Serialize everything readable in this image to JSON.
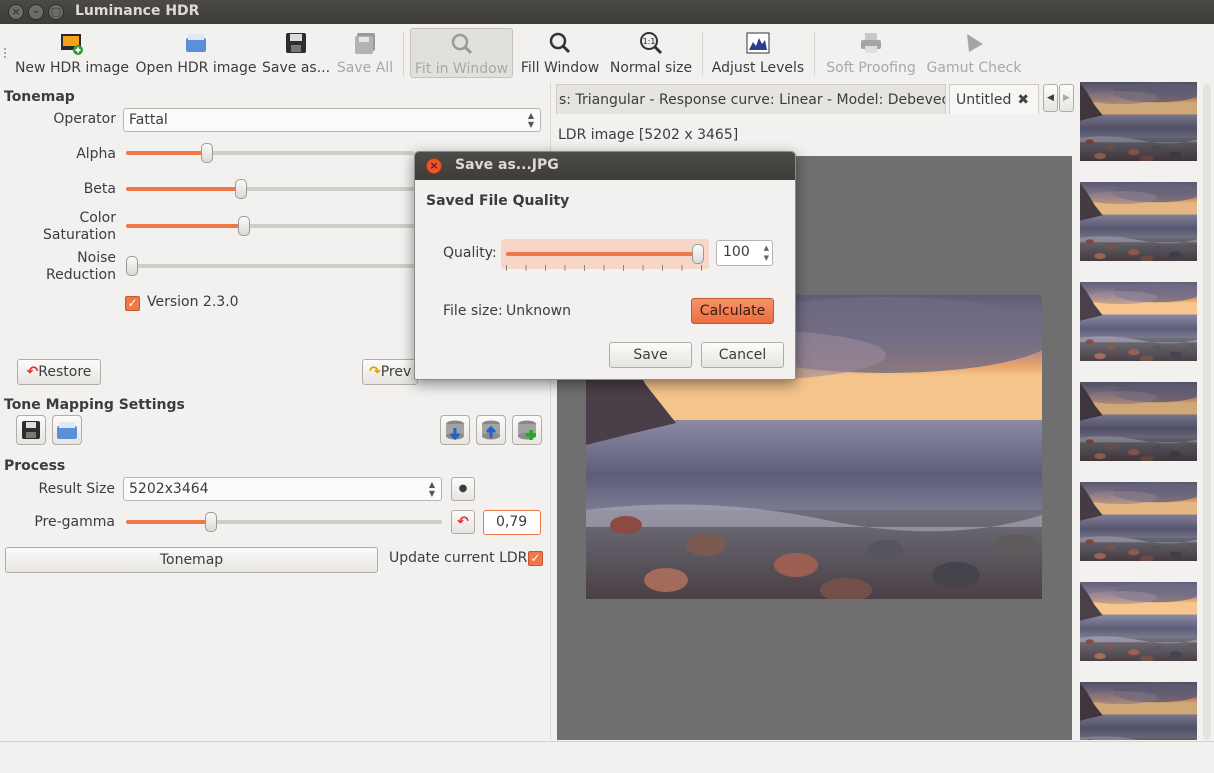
{
  "window": {
    "title": "Luminance HDR"
  },
  "toolbar": {
    "new_hdr": "New HDR image",
    "open_hdr": "Open HDR image",
    "save_as": "Save as...",
    "save_all": "Save All",
    "fit_window": "Fit in Window",
    "fill_window": "Fill Window",
    "normal_size": "Normal size",
    "normal_size_icon_text": "1:1",
    "adjust_levels": "Adjust Levels",
    "soft_proofing": "Soft Proofing",
    "gamut_check": "Gamut Check"
  },
  "tonemap": {
    "section_title": "Tonemap",
    "operator_label": "Operator",
    "operator_value": "Fattal",
    "alpha_label": "Alpha",
    "alpha_level": 0.28,
    "beta_label": "Beta",
    "beta_level": 0.4,
    "color_saturation_label": "Color Saturation",
    "color_saturation_level": 0.41,
    "noise_reduction_label": "Noise Reduction",
    "noise_reduction_level": 0.0,
    "version_label": "Version 2.3.0",
    "version_checked": true,
    "restore_button": "Restore",
    "preview_button": "Prev"
  },
  "tone_mapping_settings": {
    "section_title": "Tone Mapping Settings"
  },
  "process": {
    "section_title": "Process",
    "result_size_label": "Result Size",
    "result_size_value": "5202x3464",
    "pregamma_label": "Pre-gamma",
    "pregamma_value": "0,79",
    "pregamma_level": 0.27,
    "tonemap_button": "Tonemap",
    "update_ldr_label": "Update current LDR",
    "update_ldr_checked": true
  },
  "tabs": [
    {
      "label": "s: Triangular - Response curve: Linear - Model: Debevec"
    },
    {
      "label": "Untitled"
    }
  ],
  "image_info": "LDR image [5202 x 3465]",
  "dialog": {
    "title": "Save as...JPG",
    "section": "Saved File Quality",
    "quality_label": "Quality:",
    "quality_value": "100",
    "quality_level": 1.0,
    "file_size_label": "File size:",
    "file_size_value": "Unknown",
    "calculate_button": "Calculate",
    "save_button": "Save",
    "cancel_button": "Cancel"
  },
  "colors": {
    "accent": "#f07746",
    "titlebar": "#3c3b37",
    "viewport": "#6f6f6f"
  }
}
